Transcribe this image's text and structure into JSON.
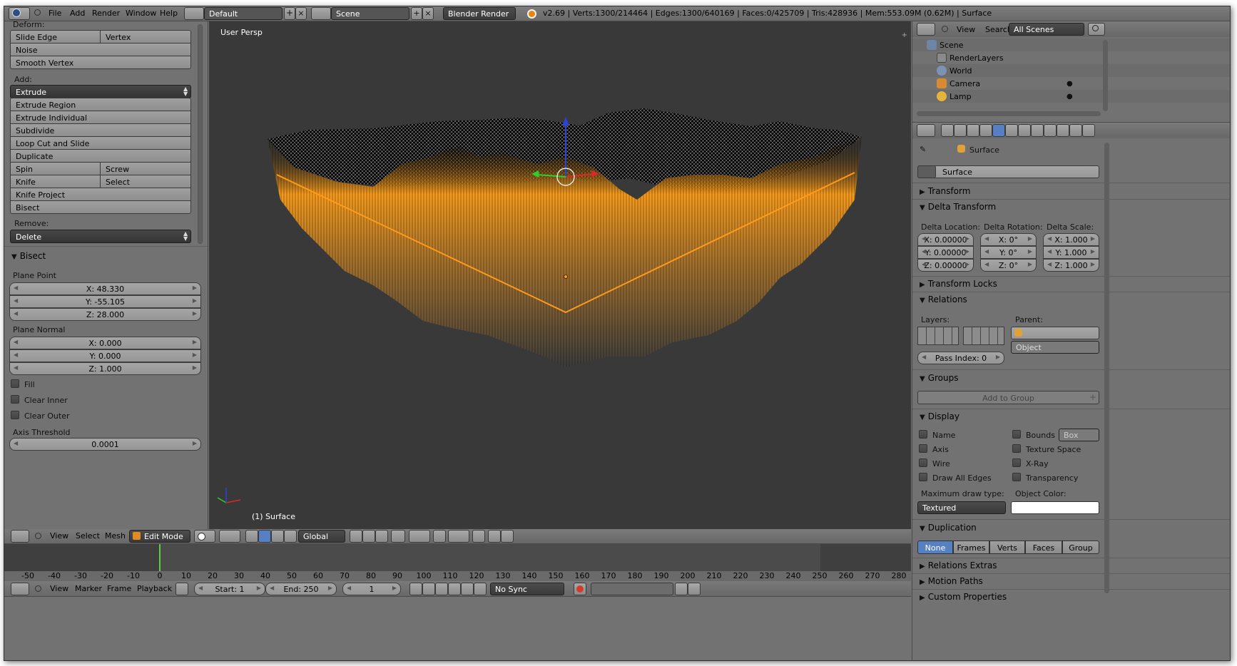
{
  "top_menu": {
    "items": [
      "File",
      "Add",
      "Render",
      "Window",
      "Help"
    ],
    "layout": "Default",
    "scene": "Scene",
    "engine": "Blender Render",
    "stats": "v2.69 | Verts:1300/214464 | Edges:1300/640169 | Faces:0/425709 | Tris:428936 | Mem:553.09M (0.62M) | Surface"
  },
  "tool_shelf": {
    "deform_label": "Deform:",
    "slide_edge": "Slide Edge",
    "vertex": "Vertex",
    "noise": "Noise",
    "smooth_vertex": "Smooth Vertex",
    "add_label": "Add:",
    "extrude": "Extrude",
    "extrude_region": "Extrude Region",
    "extrude_individual": "Extrude Individual",
    "subdivide": "Subdivide",
    "loop_cut": "Loop Cut and Slide",
    "duplicate": "Duplicate",
    "spin": "Spin",
    "screw": "Screw",
    "knife": "Knife",
    "select": "Select",
    "knife_project": "Knife Project",
    "bisect": "Bisect",
    "remove_label": "Remove:",
    "delete": "Delete"
  },
  "operator": {
    "title": "Bisect",
    "plane_point_label": "Plane Point",
    "px": "X: 48.330",
    "py": "Y: -55.105",
    "pz": "Z: 28.000",
    "plane_normal_label": "Plane Normal",
    "nx": "X: 0.000",
    "ny": "Y: 0.000",
    "nz": "Z: 1.000",
    "fill": "Fill",
    "clear_inner": "Clear Inner",
    "clear_outer": "Clear Outer",
    "axis_threshold_label": "Axis Threshold",
    "axis_threshold": "0.0001"
  },
  "viewport": {
    "view_name": "User Persp",
    "object_label": "(1) Surface"
  },
  "view3d_header": {
    "view": "View",
    "select": "Select",
    "mesh": "Mesh",
    "mode": "Edit Mode",
    "orientation": "Global"
  },
  "timeline": {
    "ticks": [
      "-50",
      "-40",
      "-30",
      "-20",
      "-10",
      "0",
      "10",
      "20",
      "30",
      "40",
      "50",
      "60",
      "70",
      "80",
      "90",
      "100",
      "110",
      "120",
      "130",
      "140",
      "150",
      "160",
      "170",
      "180",
      "190",
      "200",
      "210",
      "220",
      "230",
      "240",
      "250",
      "260",
      "270",
      "280"
    ],
    "view": "View",
    "marker": "Marker",
    "frame": "Frame",
    "playback": "Playback",
    "start": "Start: 1",
    "end": "End: 250",
    "current": "1",
    "sync": "No Sync"
  },
  "outliner": {
    "view": "View",
    "search": "Search",
    "filter": "All Scenes",
    "items": [
      {
        "label": "Scene"
      },
      {
        "label": "RenderLayers"
      },
      {
        "label": "World"
      },
      {
        "label": "Camera"
      },
      {
        "label": "Lamp"
      }
    ]
  },
  "properties": {
    "breadcrumb": "Surface",
    "object_name": "Surface",
    "transform": "Transform",
    "delta_transform": "Delta Transform",
    "delta_location_label": "Delta Location:",
    "delta_rotation_label": "Delta Rotation:",
    "delta_scale_label": "Delta Scale:",
    "loc_x": "X: 0.00000",
    "loc_y": "Y: 0.00000",
    "loc_z": "Z: 0.00000",
    "rot_x": "X: 0°",
    "rot_y": "Y: 0°",
    "rot_z": "Z: 0°",
    "scale_x": "X: 1.000",
    "scale_y": "Y: 1.000",
    "scale_z": "Z: 1.000",
    "transform_locks": "Transform Locks",
    "relations": "Relations",
    "layers_label": "Layers:",
    "parent_label": "Parent:",
    "parent_type": "Object",
    "pass_index": "Pass Index: 0",
    "groups": "Groups",
    "add_to_group": "Add to Group",
    "display": "Display",
    "name": "Name",
    "axis": "Axis",
    "wire": "Wire",
    "draw_all_edges": "Draw All Edges",
    "bounds": "Bounds",
    "bounds_type": "Box",
    "texture_space": "Texture Space",
    "xray": "X-Ray",
    "transparency": "Transparency",
    "max_draw_type_label": "Maximum draw type:",
    "max_draw_type": "Textured",
    "object_color_label": "Object Color:",
    "duplication": "Duplication",
    "dup_options": [
      "None",
      "Frames",
      "Verts",
      "Faces",
      "Group"
    ],
    "relations_extras": "Relations Extras",
    "motion_paths": "Motion Paths",
    "custom_properties": "Custom Properties"
  },
  "colors": {
    "accent": "#5680c2",
    "selected": "#ff9f1a",
    "viewport_bg": "#393939"
  }
}
